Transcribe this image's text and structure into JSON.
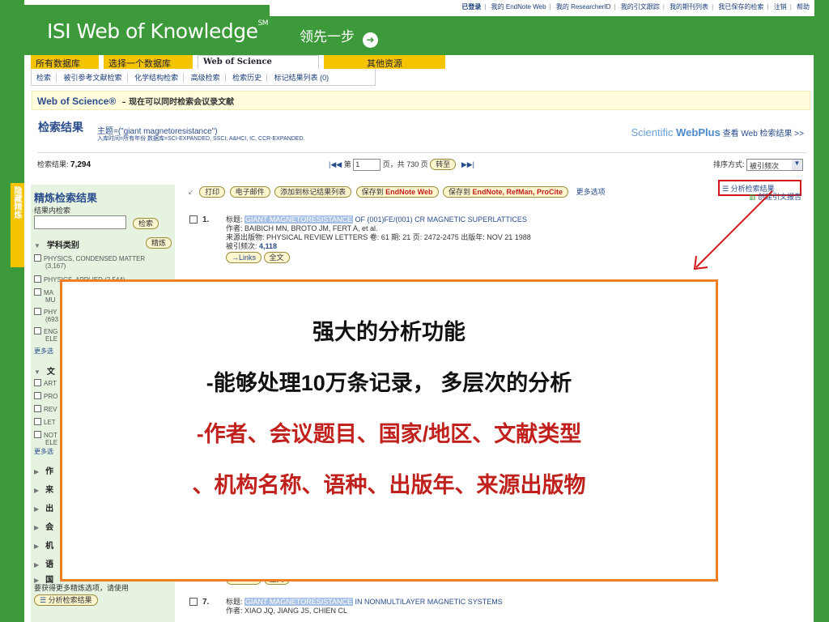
{
  "header": {
    "logo_text": "ISI Web of Knowledge",
    "logo_mark": "SM",
    "slogan": "领先一步",
    "top_links": {
      "logged_in": "已登录",
      "items": [
        "我的 EndNote Web",
        "我的 ResearcherID",
        "我的引文跟踪",
        "我的期刊列表",
        "我已保存的检索",
        "注销",
        "帮助"
      ]
    }
  },
  "tabs": {
    "all_db": "所有数据库",
    "select_db": "选择一个数据库",
    "wos": "Web of Science",
    "other": "其他资源"
  },
  "subnav": [
    "检索",
    "被引参考文献检索",
    "化学结构检索",
    "高级检索",
    "检索历史",
    "标记结果列表 (0)"
  ],
  "wos_bar": {
    "title": "Web of Science®",
    "note": "– 现在可以同时检索会议录文献"
  },
  "results_header": {
    "title": "检索结果",
    "query": "主题=(\"giant magnetoresistance\")",
    "query_details": "入库时间=所有年份  数据库=SCI-EXPANDED, SSCI, A&HCI, IC, CCR-EXPANDED.",
    "webplus_brand_a": "Scientific ",
    "webplus_brand_b": "WebPlus",
    "webplus_link": "查看 Web 检索结果 >>"
  },
  "count_bar": {
    "label": "检索结果:",
    "count": "7,294",
    "page_prefix": "第",
    "page_value": "1",
    "page_suffix": "页，共 730 页",
    "go_label": "转至",
    "sort_label": "排序方式:",
    "sort_value": "被引频次"
  },
  "hide_tab": "隐藏精炼",
  "left_panel": {
    "title": "精炼检索结果",
    "subtitle": "结果内检索",
    "search_btn": "检索",
    "category_title": "学科类别",
    "refine_btn": "精炼",
    "category_items": [
      {
        "label": "PHYSICS, CONDENSED MATTER",
        "count": "(3,167)"
      },
      {
        "label": "PHYSICS, APPLIED (2,544)",
        "count": ""
      },
      {
        "label": "MA",
        "count": "MU"
      },
      {
        "label": "PHY",
        "count": "(693"
      },
      {
        "label": "ENG",
        "count": "ELE"
      }
    ],
    "more_link": "更多选",
    "doctype_title": "文",
    "doctype_items": [
      "ART",
      "PRO",
      "REV",
      "LET",
      "NOT"
    ],
    "doctype_extra": "ELE",
    "more_link2": "更多选",
    "collapsed_sections": [
      "作",
      "来",
      "出",
      "会",
      "机",
      "语",
      "国"
    ],
    "bottom_text": "要获得更多精炼选项，请使用",
    "bottom_btn": "分析检索结果"
  },
  "actions": {
    "print": "打印",
    "email": "电子邮件",
    "add_marked": "添加到标记结果列表",
    "save_endnote_web_a": "保存到 ",
    "save_endnote_web_b": "EndNote Web",
    "save_endnote_a": "保存到 ",
    "save_endnote_b": "EndNote, RefMan, ProCite",
    "more": "更多选项",
    "analyze": "分析检索结果",
    "citation_report": "创建引文报告"
  },
  "records": [
    {
      "index": "1.",
      "title_hl": "GIANT MAGNETORESISTANCE",
      "title_rest": " OF (001)FE/(001) CR MAGNETIC SUPERLATTICES",
      "authors": "作者: BAIBICH MN, BROTO JM, FERT A, et al.",
      "source": "来源出版物: PHYSICAL REVIEW LETTERS  卷: 61  期: 21  页: 2472-2475  出版年: NOV 21 1988",
      "cited_label": "被引频次: ",
      "cited": "4,118",
      "links_btn": "Links",
      "fulltext_btn": "全文"
    },
    {
      "index": "7.",
      "title_hl": "GIANT MAGNETORESISTANCE",
      "title_rest": " IN NONMULTILAYER MAGNETIC SYSTEMS",
      "authors": "作者: XIAO JQ, JIANG JS, CHIEN CL"
    }
  ],
  "overlay": {
    "line1": "强大的分析功能",
    "line2": "-能够处理10万条记录， 多层次的分析",
    "line3": "-作者、会议题目、国家/地区、文献类型",
    "line4": "、机构名称、语种、出版年、来源出版物"
  },
  "colors": {
    "brand_green": "#3d9a3a",
    "tab_yellow": "#f5c400",
    "link_blue": "#2a4c8c",
    "highlight_red": "#c1211c",
    "overlay_border": "#f07e24"
  }
}
